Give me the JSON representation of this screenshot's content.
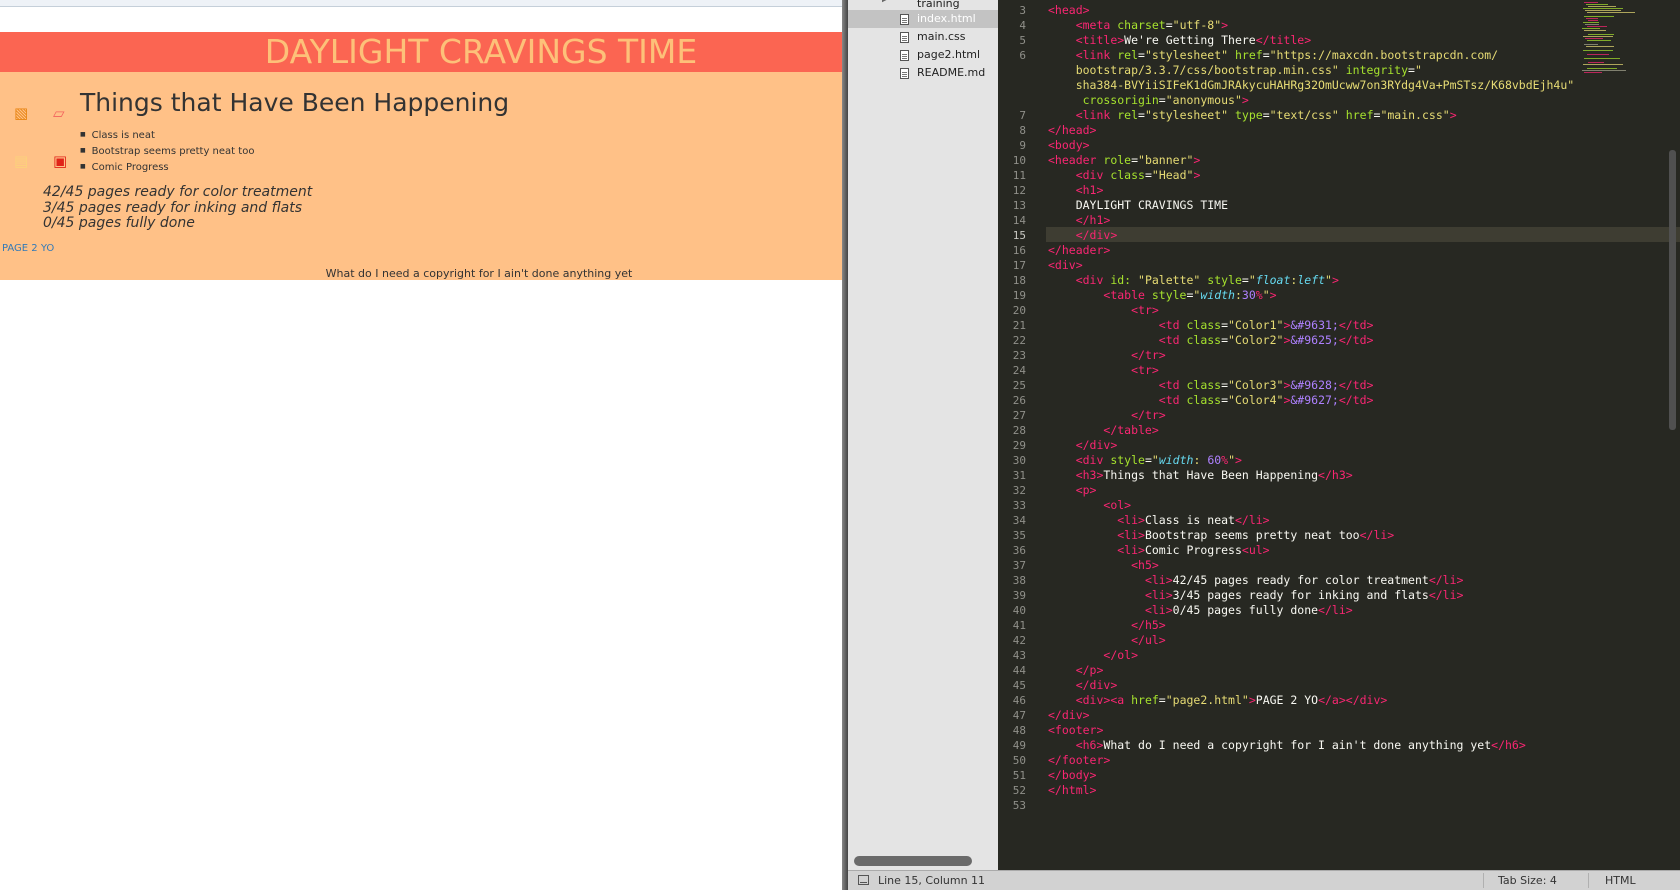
{
  "browser": {
    "site_title": "DAYLIGHT CRAVINGS TIME",
    "palette": [
      "▧",
      "▱",
      "▤",
      "▣"
    ],
    "section_heading": "Things that Have Been Happening",
    "list_items": [
      "Class is neat",
      "Bootstrap seems pretty neat too",
      "Comic Progress"
    ],
    "progress_items": [
      "42/45 pages ready for color treatment",
      "3/45 pages ready for inking and flats",
      "0/45 pages fully done"
    ],
    "page2_link": "PAGE 2 YO",
    "footer": "What do I need a copyright for I ain't done anything yet"
  },
  "sidebar": {
    "folder": "training",
    "files": [
      "index.html",
      "main.css",
      "page2.html",
      "README.md"
    ],
    "active_file": "index.html"
  },
  "status_bar": {
    "position": "Line 15, Column 11",
    "tab_size": "Tab Size: 4",
    "syntax": "HTML"
  },
  "editor": {
    "current_line": 15,
    "lines": [
      {
        "n": "3",
        "t": [
          [
            "tg",
            "<head>"
          ]
        ]
      },
      {
        "n": "4",
        "t": [
          [
            "",
            "    "
          ],
          [
            "tg",
            "<meta"
          ],
          [
            "at",
            " charset"
          ],
          [
            "",
            "="
          ],
          [
            "st",
            "\"utf-8\""
          ],
          [
            "tg",
            ">"
          ]
        ]
      },
      {
        "n": "5",
        "t": [
          [
            "",
            "    "
          ],
          [
            "tg",
            "<title>"
          ],
          [
            "",
            "We're Getting There"
          ],
          [
            "tg",
            "</title>"
          ]
        ]
      },
      {
        "n": "6",
        "t": [
          [
            "",
            "    "
          ],
          [
            "tg",
            "<link"
          ],
          [
            "at",
            " rel"
          ],
          [
            "",
            "="
          ],
          [
            "st",
            "\"stylesheet\""
          ],
          [
            "at",
            " href"
          ],
          [
            "",
            "="
          ],
          [
            "st",
            "\"https://maxcdn.bootstrapcdn.com/"
          ]
        ]
      },
      {
        "n": "",
        "t": [
          [
            "st",
            "    bootstrap/3.3.7/css/bootstrap.min.css\""
          ],
          [
            "at",
            " integrity"
          ],
          [
            "",
            "="
          ],
          [
            "st",
            "\""
          ]
        ]
      },
      {
        "n": "",
        "t": [
          [
            "st",
            "    sha384-BVYiiSIFeK1dGmJRAkycuHAHRg32OmUcww7on3RYdg4Va+PmSTsz/K68vbdEjh4u\""
          ]
        ]
      },
      {
        "n": "",
        "t": [
          [
            "at",
            "     crossorigin"
          ],
          [
            "",
            "="
          ],
          [
            "st",
            "\"anonymous\""
          ],
          [
            "tg",
            ">"
          ]
        ]
      },
      {
        "n": "7",
        "t": [
          [
            "",
            "    "
          ],
          [
            "tg",
            "<link"
          ],
          [
            "at",
            " rel"
          ],
          [
            "",
            "="
          ],
          [
            "st",
            "\"stylesheet\""
          ],
          [
            "at",
            " type"
          ],
          [
            "",
            "="
          ],
          [
            "st",
            "\"text/css\""
          ],
          [
            "at",
            " href"
          ],
          [
            "",
            "="
          ],
          [
            "st",
            "\"main.css\""
          ],
          [
            "tg",
            ">"
          ]
        ]
      },
      {
        "n": "8",
        "t": [
          [
            "tg",
            "</head>"
          ]
        ]
      },
      {
        "n": "9",
        "t": [
          [
            "tg",
            "<body>"
          ]
        ]
      },
      {
        "n": "10",
        "t": [
          [
            "tg",
            "<header"
          ],
          [
            "at",
            " role"
          ],
          [
            "",
            "="
          ],
          [
            "st",
            "\"banner\""
          ],
          [
            "tg",
            ">"
          ]
        ]
      },
      {
        "n": "11",
        "t": [
          [
            "",
            "    "
          ],
          [
            "tg",
            "<div"
          ],
          [
            "at",
            " class"
          ],
          [
            "",
            "="
          ],
          [
            "st",
            "\"Head\""
          ],
          [
            "tg",
            ">"
          ]
        ]
      },
      {
        "n": "12",
        "t": [
          [
            "",
            "    "
          ],
          [
            "tg",
            "<h1>"
          ]
        ]
      },
      {
        "n": "13",
        "t": [
          [
            "",
            "    DAYLIGHT CRAVINGS TIME"
          ]
        ]
      },
      {
        "n": "14",
        "t": [
          [
            "",
            "    "
          ],
          [
            "tg",
            "</h1>"
          ]
        ]
      },
      {
        "n": "15",
        "t": [
          [
            "",
            "    "
          ],
          [
            "tg",
            "</div>"
          ]
        ]
      },
      {
        "n": "16",
        "t": [
          [
            "tg",
            "</header>"
          ]
        ]
      },
      {
        "n": "17",
        "t": [
          [
            "tg",
            "<div>"
          ]
        ]
      },
      {
        "n": "18",
        "t": [
          [
            "",
            "    "
          ],
          [
            "tg",
            "<div"
          ],
          [
            "at",
            " id:"
          ],
          [
            "st",
            " \"Palette\""
          ],
          [
            "at",
            " style"
          ],
          [
            "",
            "="
          ],
          [
            "st",
            "\""
          ],
          [
            "pr",
            "float"
          ],
          [
            "st",
            ":"
          ],
          [
            "pr",
            "left"
          ],
          [
            "st",
            "\""
          ],
          [
            "tg",
            ">"
          ]
        ]
      },
      {
        "n": "19",
        "t": [
          [
            "",
            "        "
          ],
          [
            "tg",
            "<table"
          ],
          [
            "at",
            " style"
          ],
          [
            "",
            "="
          ],
          [
            "st",
            "\""
          ],
          [
            "pr",
            "width"
          ],
          [
            "st",
            ":"
          ],
          [
            "nm",
            "30"
          ],
          [
            "tg",
            "%"
          ],
          [
            "st",
            "\""
          ],
          [
            "tg",
            ">"
          ]
        ]
      },
      {
        "n": "20",
        "t": [
          [
            "",
            "            "
          ],
          [
            "tg",
            "<tr>"
          ]
        ]
      },
      {
        "n": "21",
        "t": [
          [
            "",
            "                "
          ],
          [
            "tg",
            "<td"
          ],
          [
            "at",
            " class"
          ],
          [
            "",
            "="
          ],
          [
            "st",
            "\"Color1\""
          ],
          [
            "tg",
            ">"
          ],
          [
            "nm",
            "&#9631;"
          ],
          [
            "tg",
            "</td>"
          ]
        ]
      },
      {
        "n": "22",
        "t": [
          [
            "",
            "                "
          ],
          [
            "tg",
            "<td"
          ],
          [
            "at",
            " class"
          ],
          [
            "",
            "="
          ],
          [
            "st",
            "\"Color2\""
          ],
          [
            "tg",
            ">"
          ],
          [
            "nm",
            "&#9625;"
          ],
          [
            "tg",
            "</td>"
          ]
        ]
      },
      {
        "n": "23",
        "t": [
          [
            "",
            "            "
          ],
          [
            "tg",
            "</tr>"
          ]
        ]
      },
      {
        "n": "24",
        "t": [
          [
            "",
            "            "
          ],
          [
            "tg",
            "<tr>"
          ]
        ]
      },
      {
        "n": "25",
        "t": [
          [
            "",
            "                "
          ],
          [
            "tg",
            "<td"
          ],
          [
            "at",
            " class"
          ],
          [
            "",
            "="
          ],
          [
            "st",
            "\"Color3\""
          ],
          [
            "tg",
            ">"
          ],
          [
            "nm",
            "&#9628;"
          ],
          [
            "tg",
            "</td>"
          ]
        ]
      },
      {
        "n": "26",
        "t": [
          [
            "",
            "                "
          ],
          [
            "tg",
            "<td"
          ],
          [
            "at",
            " class"
          ],
          [
            "",
            "="
          ],
          [
            "st",
            "\"Color4\""
          ],
          [
            "tg",
            ">"
          ],
          [
            "nm",
            "&#9627;"
          ],
          [
            "tg",
            "</td>"
          ]
        ]
      },
      {
        "n": "27",
        "t": [
          [
            "",
            "            "
          ],
          [
            "tg",
            "</tr>"
          ]
        ]
      },
      {
        "n": "28",
        "t": [
          [
            "",
            "        "
          ],
          [
            "tg",
            "</table>"
          ]
        ]
      },
      {
        "n": "29",
        "t": [
          [
            "",
            "    "
          ],
          [
            "tg",
            "</div>"
          ]
        ]
      },
      {
        "n": "30",
        "t": [
          [
            "",
            "    "
          ],
          [
            "tg",
            "<div"
          ],
          [
            "at",
            " style"
          ],
          [
            "",
            "="
          ],
          [
            "st",
            "\""
          ],
          [
            "pr",
            "width"
          ],
          [
            "st",
            ": "
          ],
          [
            "nm",
            "60"
          ],
          [
            "tg",
            "%"
          ],
          [
            "st",
            "\""
          ],
          [
            "tg",
            ">"
          ]
        ]
      },
      {
        "n": "31",
        "t": [
          [
            "",
            "    "
          ],
          [
            "tg",
            "<h3>"
          ],
          [
            "",
            "Things that Have Been Happening"
          ],
          [
            "tg",
            "</h3>"
          ]
        ]
      },
      {
        "n": "32",
        "t": [
          [
            "",
            "    "
          ],
          [
            "tg",
            "<p>"
          ]
        ]
      },
      {
        "n": "33",
        "t": [
          [
            "",
            "        "
          ],
          [
            "tg",
            "<ol>"
          ]
        ]
      },
      {
        "n": "34",
        "t": [
          [
            "",
            "          "
          ],
          [
            "tg",
            "<li>"
          ],
          [
            "",
            "Class is neat"
          ],
          [
            "tg",
            "</li>"
          ]
        ]
      },
      {
        "n": "35",
        "t": [
          [
            "",
            "          "
          ],
          [
            "tg",
            "<li>"
          ],
          [
            "",
            "Bootstrap seems pretty neat too"
          ],
          [
            "tg",
            "</li>"
          ]
        ]
      },
      {
        "n": "36",
        "t": [
          [
            "",
            "          "
          ],
          [
            "tg",
            "<li>"
          ],
          [
            "",
            "Comic Progress"
          ],
          [
            "tg",
            "<ul>"
          ]
        ]
      },
      {
        "n": "37",
        "t": [
          [
            "",
            "            "
          ],
          [
            "tg",
            "<h5>"
          ]
        ]
      },
      {
        "n": "38",
        "t": [
          [
            "",
            "              "
          ],
          [
            "tg",
            "<li>"
          ],
          [
            "",
            "42/45 pages ready for color treatment"
          ],
          [
            "tg",
            "</li>"
          ]
        ]
      },
      {
        "n": "39",
        "t": [
          [
            "",
            "              "
          ],
          [
            "tg",
            "<li>"
          ],
          [
            "",
            "3/45 pages ready for inking and flats"
          ],
          [
            "tg",
            "</li>"
          ]
        ]
      },
      {
        "n": "40",
        "t": [
          [
            "",
            "              "
          ],
          [
            "tg",
            "<li>"
          ],
          [
            "",
            "0/45 pages fully done"
          ],
          [
            "tg",
            "</li>"
          ]
        ]
      },
      {
        "n": "41",
        "t": [
          [
            "",
            "            "
          ],
          [
            "tg",
            "</h5>"
          ]
        ]
      },
      {
        "n": "42",
        "t": [
          [
            "",
            "            "
          ],
          [
            "tg",
            "</ul>"
          ]
        ]
      },
      {
        "n": "43",
        "t": [
          [
            "",
            "        "
          ],
          [
            "tg",
            "</ol>"
          ]
        ]
      },
      {
        "n": "44",
        "t": [
          [
            "",
            "    "
          ],
          [
            "tg",
            "</p>"
          ]
        ]
      },
      {
        "n": "45",
        "t": [
          [
            "",
            "    "
          ],
          [
            "tg",
            "</div>"
          ]
        ]
      },
      {
        "n": "46",
        "t": [
          [
            "",
            "    "
          ],
          [
            "tg",
            "<div><a"
          ],
          [
            "at",
            " href"
          ],
          [
            "",
            "="
          ],
          [
            "st",
            "\"page2.html\""
          ],
          [
            "tg",
            ">"
          ],
          [
            "",
            "PAGE 2 YO"
          ],
          [
            "tg",
            "</a></div>"
          ]
        ]
      },
      {
        "n": "47",
        "t": [
          [
            "tg",
            "</div>"
          ]
        ]
      },
      {
        "n": "48",
        "t": [
          [
            "tg",
            "<footer>"
          ]
        ]
      },
      {
        "n": "49",
        "t": [
          [
            "",
            "    "
          ],
          [
            "tg",
            "<h6>"
          ],
          [
            "",
            "What do I need a copyright for I ain't done anything yet"
          ],
          [
            "tg",
            "</h6>"
          ]
        ]
      },
      {
        "n": "50",
        "t": [
          [
            "tg",
            "</footer>"
          ]
        ]
      },
      {
        "n": "51",
        "t": [
          [
            "tg",
            "</body>"
          ]
        ]
      },
      {
        "n": "52",
        "t": [
          [
            "tg",
            "</html>"
          ]
        ]
      },
      {
        "n": "53",
        "t": []
      }
    ]
  }
}
